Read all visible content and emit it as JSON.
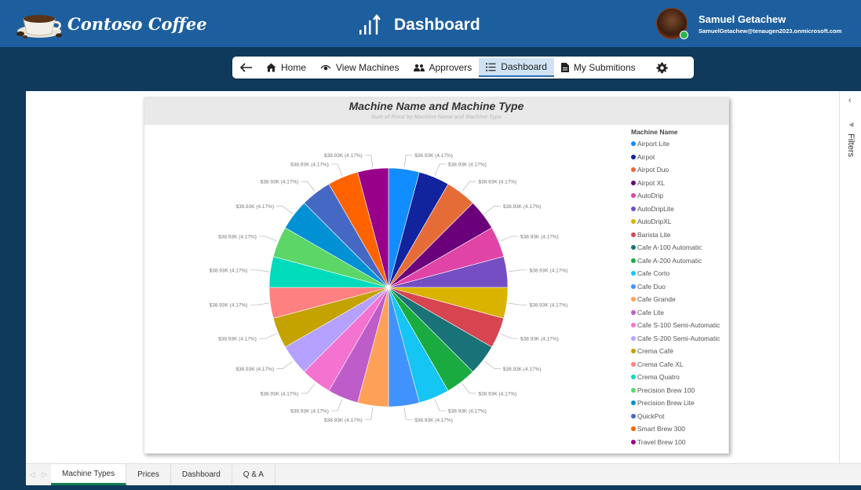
{
  "header": {
    "logo_text": "Contoso Coffee",
    "title": "Dashboard",
    "user_name": "Samuel Getachew",
    "user_email": "SamuelGetachew@tenaugen2023.onmicrosoft.com"
  },
  "nav": {
    "back_icon": "back-arrow-icon",
    "items": [
      {
        "label": "Home",
        "icon": "home-icon"
      },
      {
        "label": "View Machines",
        "icon": "eye-icon"
      },
      {
        "label": "Approvers",
        "icon": "people-icon"
      },
      {
        "label": "Dashboard",
        "icon": "list-icon"
      },
      {
        "label": "My Submitions",
        "icon": "document-icon"
      }
    ],
    "settings_icon": "gear-icon"
  },
  "visual": {
    "title": "Machine Name and Machine Type",
    "subtitle": "Sum of Price by Machine Name and Machine Type"
  },
  "chart_data": {
    "type": "pie",
    "title": "Machine Name and Machine Type",
    "subtitle": "Sum of Price by Machine Name and Machine Type",
    "legend_title": "Machine Name",
    "legend_position": "right",
    "slice_label": "$38.93K (4.17%)",
    "categories": [
      "Airport Lite",
      "Airpot",
      "Airpot Duo",
      "Airpot XL",
      "AutoDrip",
      "AutoDripLite",
      "AutoDripXL",
      "Barista Lite",
      "Cafe A-100 Automatic",
      "Cafe A-200 Automatic",
      "Cafe Corto",
      "Cafe Duo",
      "Cafe Grande",
      "Cafe Lite",
      "Cafe S-100 Semi-Automatic",
      "Cafe S-200 Semi-Automatic",
      "Crema Café",
      "Crema Cafe XL",
      "Crema Quatro",
      "Precision Brew 100",
      "Precision Brew Lite",
      "QuickPot",
      "Smart Brew 300",
      "Travel Brew 100"
    ],
    "values": [
      38.93,
      38.93,
      38.93,
      38.93,
      38.93,
      38.93,
      38.93,
      38.93,
      38.93,
      38.93,
      38.93,
      38.93,
      38.93,
      38.93,
      38.93,
      38.93,
      38.93,
      38.93,
      38.93,
      38.93,
      38.93,
      38.93,
      38.93,
      38.93
    ],
    "colors": [
      "#118DFF",
      "#12239E",
      "#E66C37",
      "#6B007B",
      "#E044A7",
      "#744EC2",
      "#D9B300",
      "#D64550",
      "#197278",
      "#1AAB40",
      "#15C6F4",
      "#4092FF",
      "#FFA058",
      "#BE5DC9",
      "#F472D0",
      "#B5A1FF",
      "#C4A200",
      "#FF8080",
      "#00DBBC",
      "#5BD667",
      "#0091D5",
      "#4668C5",
      "#FF6300",
      "#99008A"
    ]
  },
  "filters": {
    "label": "Filters"
  },
  "tabs": [
    {
      "label": "Machine Types"
    },
    {
      "label": "Prices"
    },
    {
      "label": "Dashboard"
    },
    {
      "label": "Q & A"
    }
  ]
}
